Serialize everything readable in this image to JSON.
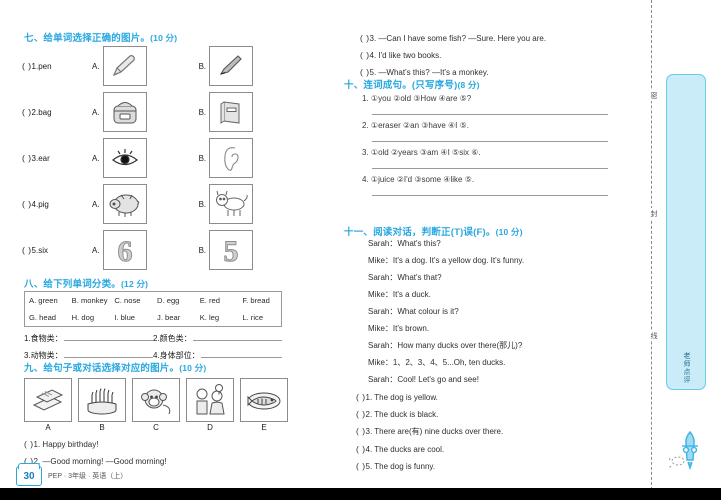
{
  "sections": {
    "s7": {
      "title": "七、给单词选择正确的图片。",
      "points": "(10 分)",
      "items": [
        {
          "paren": "(    )",
          "num": "1.",
          "word": "pen",
          "a": "pencil-icon",
          "b": "pen-icon"
        },
        {
          "paren": "(    )",
          "num": "2.",
          "word": "bag",
          "a": "schoolbag-icon",
          "b": "book-icon"
        },
        {
          "paren": "(    )",
          "num": "3.",
          "word": "ear",
          "a": "eye-icon",
          "b": "ear-icon"
        },
        {
          "paren": "(    )",
          "num": "4.",
          "word": "pig",
          "a": "pig-icon",
          "b": "dog-icon"
        },
        {
          "paren": "(    )",
          "num": "5.",
          "word": "six",
          "a": "number-six-icon",
          "b": "number-five-icon"
        }
      ],
      "optionA": "A.",
      "optionB": "B."
    },
    "s8": {
      "title": "八、给下列单词分类。",
      "points": "(12 分)",
      "bank_row1": [
        "A. green",
        "B. monkey",
        "C. nose",
        "D. egg",
        "E. red",
        "F. bread"
      ],
      "bank_row2": [
        "G. head",
        "H. dog",
        "I. blue",
        "J. bear",
        "K. leg",
        "L. rice"
      ],
      "categories": [
        {
          "num": "1.",
          "label": "食物类："
        },
        {
          "num": "2.",
          "label": "颜色类："
        },
        {
          "num": "3.",
          "label": "动物类："
        },
        {
          "num": "4.",
          "label": "身体部位："
        }
      ]
    },
    "s9": {
      "title": "九、给句子或对话选择对应的图片。",
      "points": "(10 分)",
      "pictures": [
        {
          "cap": "A",
          "icon": "books-icon"
        },
        {
          "cap": "B",
          "icon": "birthday-cake-icon"
        },
        {
          "cap": "C",
          "icon": "monkey-icon"
        },
        {
          "cap": "D",
          "icon": "children-greeting-icon"
        },
        {
          "cap": "E",
          "icon": "fish-plate-icon"
        }
      ],
      "questions": [
        {
          "paren": "(      )",
          "text": "1. Happy birthday!"
        },
        {
          "paren": "(      )",
          "text": "2. —Good morning!      —Good morning!"
        },
        {
          "paren": "(      )",
          "text": "3. —Can I have some fish?      —Sure. Here you are."
        },
        {
          "paren": "(      )",
          "text": "4. I'd like two books."
        },
        {
          "paren": "(      )",
          "text": "5. —What's this?      —It's a monkey."
        }
      ]
    },
    "s10": {
      "title": "十、连词成句。(只写序号)",
      "points": "(8 分)",
      "items": [
        "1. ①you   ②old   ③How   ④are   ⑤?",
        "2. ①eraser   ②an   ③have   ④I   ⑤.",
        "3. ①old   ②years   ③am   ④I   ⑤six   ⑥.",
        "4. ①juice   ②I'd   ③some   ④like   ⑤."
      ]
    },
    "s11": {
      "title": "十一、阅读对话，判断正(T)误(F)。",
      "points": "(10 分)",
      "dialogue": [
        "Sarah：What's this?",
        "Mike：It's a dog. It's a yellow dog. It's funny.",
        "Sarah：What's that?",
        "Mike：It's a duck.",
        "Sarah：What colour is it?",
        "Mike：It's brown.",
        "Sarah：How many ducks over there(那儿)?",
        "Mike：1、2、3、4、5...Oh, ten ducks.",
        "Sarah：Cool! Let's go and see!"
      ],
      "statements": [
        {
          "paren": "(      )",
          "text": "1. The dog is yellow."
        },
        {
          "paren": "(      )",
          "text": "2. The duck is black."
        },
        {
          "paren": "(      )",
          "text": "3. There are(有) nine ducks over there."
        },
        {
          "paren": "(      )",
          "text": "4. The ducks are cool."
        },
        {
          "paren": "(      )",
          "text": "5. The dog is funny."
        }
      ]
    }
  },
  "sidebar": {
    "teacher_label": "老师点评",
    "fold_chars": [
      "密",
      "封",
      "线"
    ]
  },
  "footer": {
    "page_number": "30",
    "imprint": "PEP · 3年级 · 英语（上）"
  },
  "colors": {
    "accent": "#29a8e0",
    "panel": "#c9ecf8",
    "border": "#8c8c8c"
  }
}
